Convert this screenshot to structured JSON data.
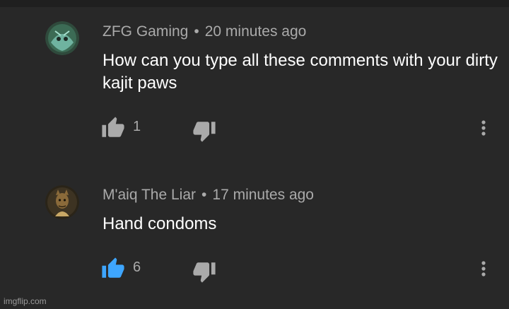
{
  "comments": [
    {
      "author": "ZFG Gaming",
      "separator": "•",
      "time": "20 minutes ago",
      "text": "How can you type all these comments with your dirty kajit paws",
      "like_count": "1",
      "liked": false,
      "avatar_icon": "zfg-avatar"
    },
    {
      "author": "M'aiq The Liar",
      "separator": "•",
      "time": "17 minutes ago",
      "text": "Hand condoms",
      "like_count": "6",
      "liked": true,
      "avatar_icon": "maiq-avatar"
    }
  ],
  "colors": {
    "background": "#282828",
    "meta_text": "#aaaaaa",
    "icon_inactive": "#aaaaaa",
    "like_active": "#3ea6ff"
  },
  "watermark": "imgflip.com"
}
